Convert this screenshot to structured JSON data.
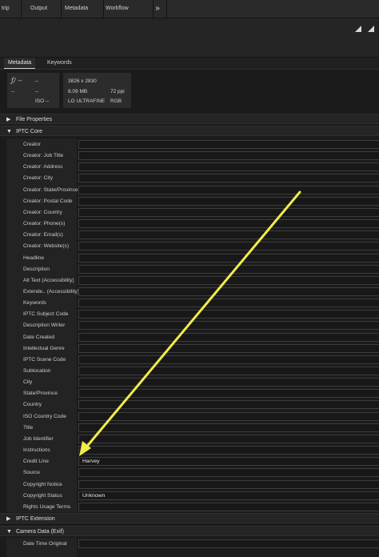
{
  "topbar": {
    "tabs": [
      "trip",
      "Output",
      "Metadata",
      "Workflow"
    ],
    "more_icon": "»"
  },
  "panel_tabs": {
    "metadata": "Metadata",
    "keywords": "Keywords"
  },
  "summary": {
    "aperture": "ƒ/ --",
    "shutter": "--",
    "exposure_bias": "--",
    "focal": "--",
    "iso": "ISO --",
    "dimensions": "3826 x 2830",
    "file_size": "8.09 MB",
    "resolution": "72 ppi",
    "color_profile": "LG ULTRAFINE",
    "color_mode": "RGB"
  },
  "sections": {
    "file_properties": "File Properties",
    "iptc_core": "IPTC Core",
    "iptc_extension": "IPTC Extension",
    "camera_data": "Camera Data (Exif)"
  },
  "iptc_rows": [
    {
      "label": "Creator",
      "value": ""
    },
    {
      "label": "Creator: Job Title",
      "value": ""
    },
    {
      "label": "Creator: Address",
      "value": ""
    },
    {
      "label": "Creator: City",
      "value": ""
    },
    {
      "label": "Creator: State/Province",
      "value": ""
    },
    {
      "label": "Creator: Postal Code",
      "value": ""
    },
    {
      "label": "Creator: Country",
      "value": ""
    },
    {
      "label": "Creator: Phone(s)",
      "value": ""
    },
    {
      "label": "Creator: Email(s)",
      "value": ""
    },
    {
      "label": "Creator: Website(s)",
      "value": ""
    },
    {
      "label": "Headline",
      "value": ""
    },
    {
      "label": "Description",
      "value": ""
    },
    {
      "label": "Alt Text (Accessibility)",
      "value": ""
    },
    {
      "label": "Extende.. (Accessibility)",
      "value": ""
    },
    {
      "label": "Keywords",
      "value": ""
    },
    {
      "label": "IPTC Subject Code",
      "value": ""
    },
    {
      "label": "Description Writer",
      "value": ""
    },
    {
      "label": "Date Created",
      "value": ""
    },
    {
      "label": "Intellectual Genre",
      "value": ""
    },
    {
      "label": "IPTC Scene Code",
      "value": ""
    },
    {
      "label": "Sublocation",
      "value": ""
    },
    {
      "label": "City",
      "value": ""
    },
    {
      "label": "State/Province",
      "value": ""
    },
    {
      "label": "Country",
      "value": ""
    },
    {
      "label": "ISO Country Code",
      "value": ""
    },
    {
      "label": "Title",
      "value": ""
    },
    {
      "label": "Job Identifier",
      "value": ""
    },
    {
      "label": "Instructions",
      "value": ""
    },
    {
      "label": "Credit Line",
      "value": "Harvey"
    },
    {
      "label": "Source",
      "value": ""
    },
    {
      "label": "Copyright Notice",
      "value": ""
    },
    {
      "label": "Copyright Status",
      "value": "Unknown"
    },
    {
      "label": "Rights Usage Terms",
      "value": ""
    }
  ],
  "camera_rows": [
    {
      "label": "Date Time Original",
      "value": ""
    }
  ],
  "annotation": {
    "arrow_color": "#f2ec4a"
  }
}
